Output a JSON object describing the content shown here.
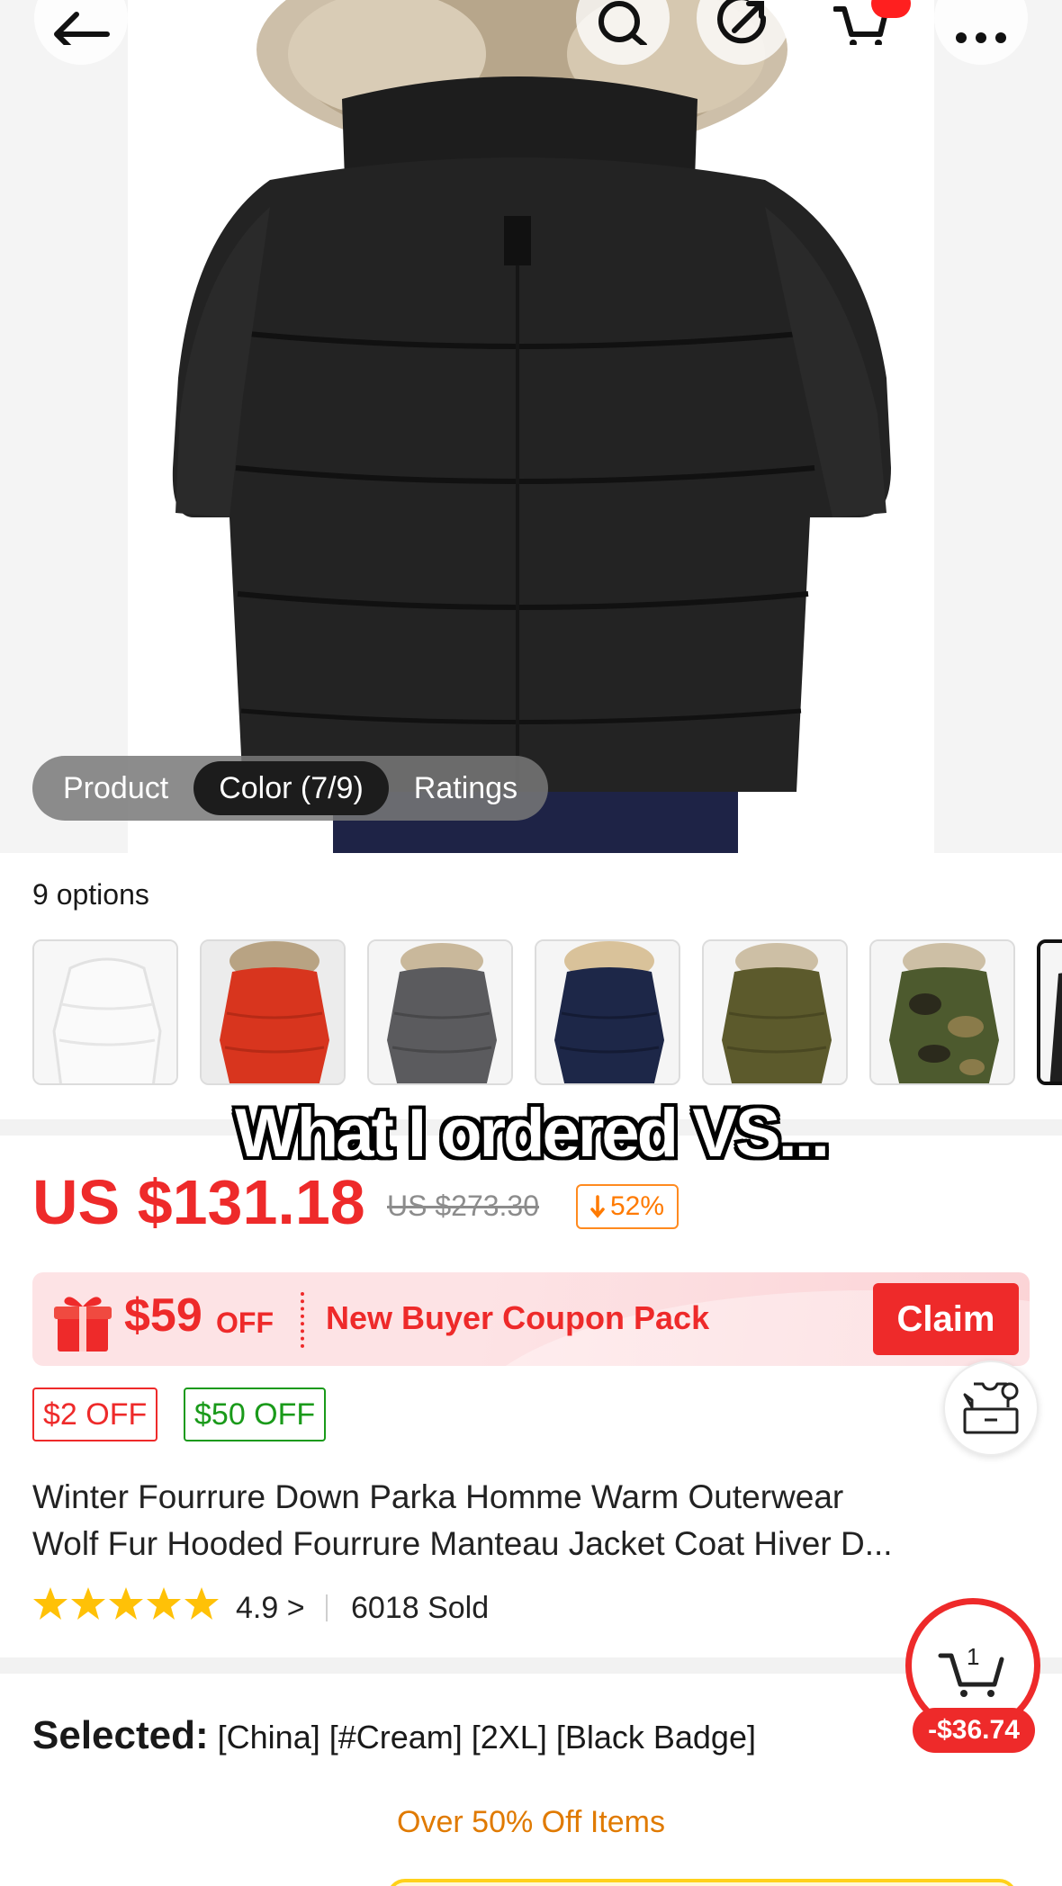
{
  "gallery": {
    "tabs": [
      {
        "label": "Product"
      },
      {
        "label": "Color (7/9)"
      },
      {
        "label": "Ratings"
      }
    ],
    "active_tab": "Color (7/9)"
  },
  "options": {
    "label": "9 options"
  },
  "overlay_caption": "What I ordered VS...",
  "price": {
    "current": "US $131.18",
    "original": "US $273.30",
    "discount": "52%"
  },
  "coupon": {
    "amount": "$59",
    "off": "OFF",
    "text": "New Buyer Coupon Pack",
    "button": "Claim"
  },
  "tags": [
    "$2 OFF",
    "$50 OFF"
  ],
  "product": {
    "title_line1": "Winter Fourrure Down Parka Homme Warm Outerwear",
    "title_line2": "Wolf Fur Hooded Fourrure Manteau Jacket Coat Hiver D...",
    "rating": "4.9 >",
    "sold": "6018 Sold"
  },
  "selected": {
    "label": "Selected:",
    "value": "[China] [#Cream] [2XL] [Black Badge]"
  },
  "promo_banner": "Over 50% Off Items",
  "floating_cart": {
    "count": "1",
    "saving": "-$36.74"
  },
  "colors": {
    "accent_red": "#ee2a2a",
    "discount_orange": "#ff7a00",
    "green_tag": "#1a9a1a"
  }
}
